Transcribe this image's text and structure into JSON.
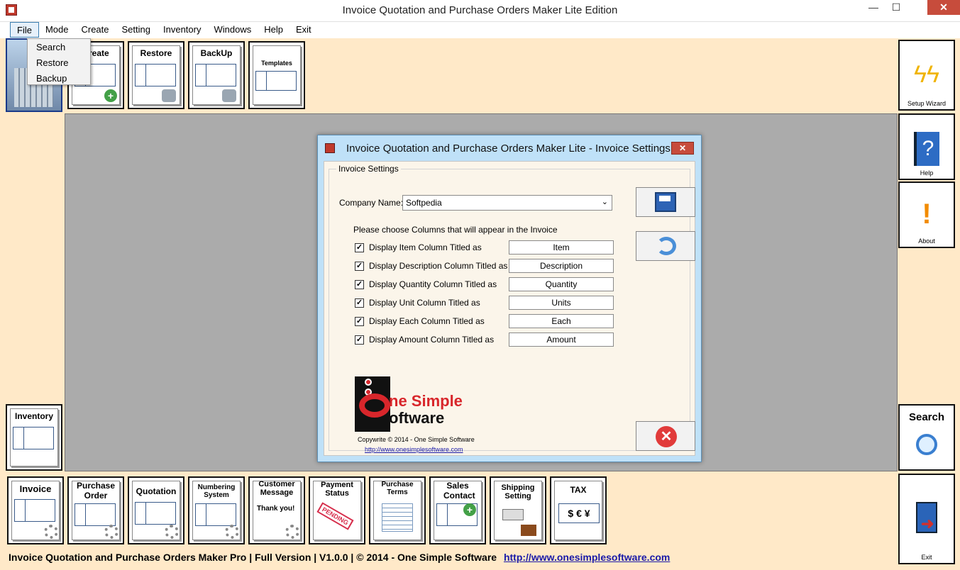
{
  "window": {
    "title": "Invoice Quotation and Purchase Orders Maker Lite Edition",
    "min": "—",
    "max": "☐",
    "close": "✕"
  },
  "menu": {
    "items": [
      "File",
      "Mode",
      "Create",
      "Setting",
      "Inventory",
      "Windows",
      "Help",
      "Exit"
    ],
    "file_dropdown": [
      "Search",
      "Restore",
      "Backup"
    ]
  },
  "top_toolbar": {
    "create": "Create",
    "restore": "Restore",
    "backup": "BackUp",
    "templates": "Templates"
  },
  "side_buttons": {
    "setup_wizard": "Setup Wizard",
    "help": "Help",
    "about": "About",
    "search": "Search",
    "exit": "Exit",
    "inventory": "Inventory"
  },
  "bottom_toolbar": {
    "invoice": "Invoice",
    "purchase_order": "Purchase Order",
    "quotation": "Quotation",
    "numbering_system": "Numbering System",
    "customer_message": "Customer Message",
    "customer_message_thanks": "Thank you!",
    "payment_status": "Payment Status",
    "payment_stamp": "PENDING",
    "purchase_terms": "Purchase Terms",
    "sales_contact": "Sales Contact",
    "shipping_setting": "Shipping Setting",
    "tax": "TAX"
  },
  "statusbar": {
    "text": "Invoice Quotation and Purchase Orders Maker Pro  |  Full Version  |  V1.0.0  |  © 2014 - One Simple Software",
    "link": "http://www.onesimplesoftware.com"
  },
  "dialog": {
    "title": "Invoice Quotation and Purchase Orders Maker Lite - Invoice Settings",
    "group_label": "Invoice Settings",
    "company_label": "Company Name:",
    "company_value": "Softpedia",
    "choose_label": "Please choose Columns that will appear in the Invoice",
    "columns": [
      {
        "label": "Display Item Column Titled as",
        "value": "Item",
        "checked": true
      },
      {
        "label": "Display Description Column Titled as",
        "value": "Description",
        "checked": true
      },
      {
        "label": "Display Quantity Column Titled as",
        "value": "Quantity",
        "checked": true
      },
      {
        "label": "Display Unit Column Titled as",
        "value": "Units",
        "checked": true
      },
      {
        "label": "Display Each Column Titled as",
        "value": "Each",
        "checked": true
      },
      {
        "label": "Display Amount Column Titled as",
        "value": "Amount",
        "checked": true
      }
    ],
    "logo_line1": "ne Simple",
    "logo_line2": "oftware",
    "copyright": "Copywrite © 2014 - One Simple Software",
    "url": "http://www.onesimplesoftware.com",
    "check_mark": "✓",
    "close_x": "✕",
    "cancel_x": "✕"
  },
  "colors": {
    "panel_bg": "#ffe9c8",
    "workspace": "#ababab",
    "dialog_frame": "#bfe1f8",
    "close_red": "#c74c3c"
  }
}
